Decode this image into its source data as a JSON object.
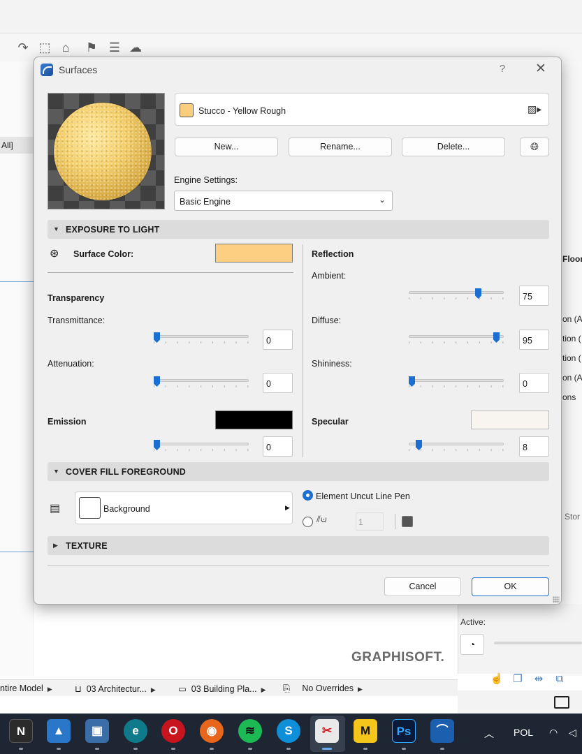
{
  "dialog": {
    "title": "Surfaces",
    "help": "?",
    "close": "✕"
  },
  "surface": {
    "name": "Stucco - Yellow Rough",
    "swatch_color": "#fbcd7e"
  },
  "buttons": {
    "new": "New...",
    "rename": "Rename...",
    "delete": "Delete...",
    "cancel": "Cancel",
    "ok": "OK"
  },
  "engine": {
    "label": "Engine Settings:",
    "value": "Basic Engine"
  },
  "exposure": {
    "section_title": "EXPOSURE TO LIGHT",
    "surface_color_label": "Surface Color:",
    "surface_color": "#fdcf82",
    "transparency_label": "Transparency",
    "transmittance_label": "Transmittance:",
    "transmittance": "0",
    "transmittance_fraction": 0.0,
    "attenuation_label": "Attenuation:",
    "attenuation": "0",
    "attenuation_fraction": 0.0,
    "emission_label": "Emission",
    "emission_color": "#000000",
    "emission": "0",
    "emission_fraction": 0.0,
    "reflection_label": "Reflection",
    "ambient_label": "Ambient:",
    "ambient": "75",
    "ambient_fraction": 0.75,
    "diffuse_label": "Diffuse:",
    "diffuse": "95",
    "diffuse_fraction": 0.95,
    "shininess_label": "Shininess:",
    "shininess": "0",
    "shininess_fraction": 0.0,
    "specular_label": "Specular",
    "specular_color": "#f8f4f0",
    "specular": "8",
    "specular_fraction": 0.08
  },
  "cover_fill": {
    "section_title": "COVER FILL FOREGROUND",
    "fill_name": "Background",
    "option_label": "Element Uncut Line Pen",
    "pen_number": "1"
  },
  "texture": {
    "section_title": "TEXTURE"
  },
  "background_app": {
    "left_tab": "All]",
    "right_texts": [
      "Floor",
      "on (A",
      "tion (",
      "tion (",
      "on (A",
      "ons",
      "Stor"
    ],
    "active_label": "Active:",
    "brand": "GRAPHISOFT.",
    "statusbar": [
      "ntire Model",
      "03 Architectur...",
      "03 Building Pla...",
      "No Overrides"
    ]
  },
  "taskbar": {
    "tray_lang": "POL"
  },
  "colors": {
    "accent": "#1b6fd1",
    "taskbar": "#1f2633"
  }
}
